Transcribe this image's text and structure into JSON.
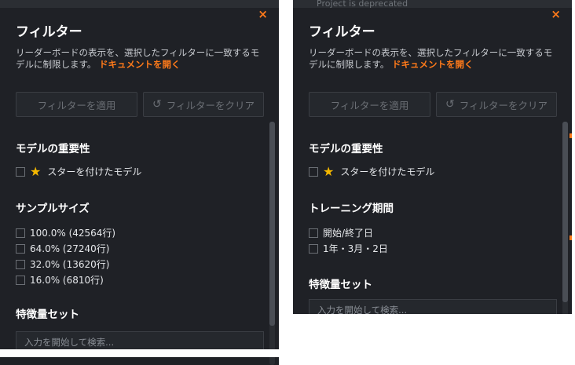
{
  "left": {
    "title": "フィルター",
    "close_glyph": "×",
    "desc_text": "リーダーボードの表示を、選択したフィルターに一致するモデルに制限します。",
    "doc_link": "ドキュメントを開く",
    "apply_label": "フィルターを適用",
    "clear_label": "フィルターをクリア",
    "clear_icon": "undo-icon",
    "sections": {
      "importance": {
        "heading": "モデルの重要性",
        "item": "スターを付けたモデル"
      },
      "sample": {
        "heading": "サンプルサイズ",
        "items": [
          "100.0% (42564行)",
          "64.0% (27240行)",
          "32.0% (13620行)",
          "16.0% (6810行)"
        ]
      },
      "features": {
        "heading": "特徴量セット",
        "placeholder": "入力を開始して検索..."
      }
    }
  },
  "right": {
    "top_text": "Project is deprecated",
    "title": "フィルター",
    "close_glyph": "×",
    "desc_text": "リーダーボードの表示を、選択したフィルターに一致するモデルに制限します。",
    "doc_link": "ドキュメントを開く",
    "apply_label": "フィルターを適用",
    "clear_label": "フィルターをクリア",
    "sections": {
      "importance": {
        "heading": "モデルの重要性",
        "item": "スターを付けたモデル"
      },
      "training": {
        "heading": "トレーニング期間",
        "items": [
          "開始/終了日",
          "1年・3月・2日"
        ]
      },
      "features": {
        "heading": "特徴量セット",
        "placeholder": "入力を開始して検索..."
      }
    }
  },
  "colors": {
    "accent": "#ff7a1a",
    "panel_bg": "#1f2126",
    "star": "#f5b800"
  }
}
